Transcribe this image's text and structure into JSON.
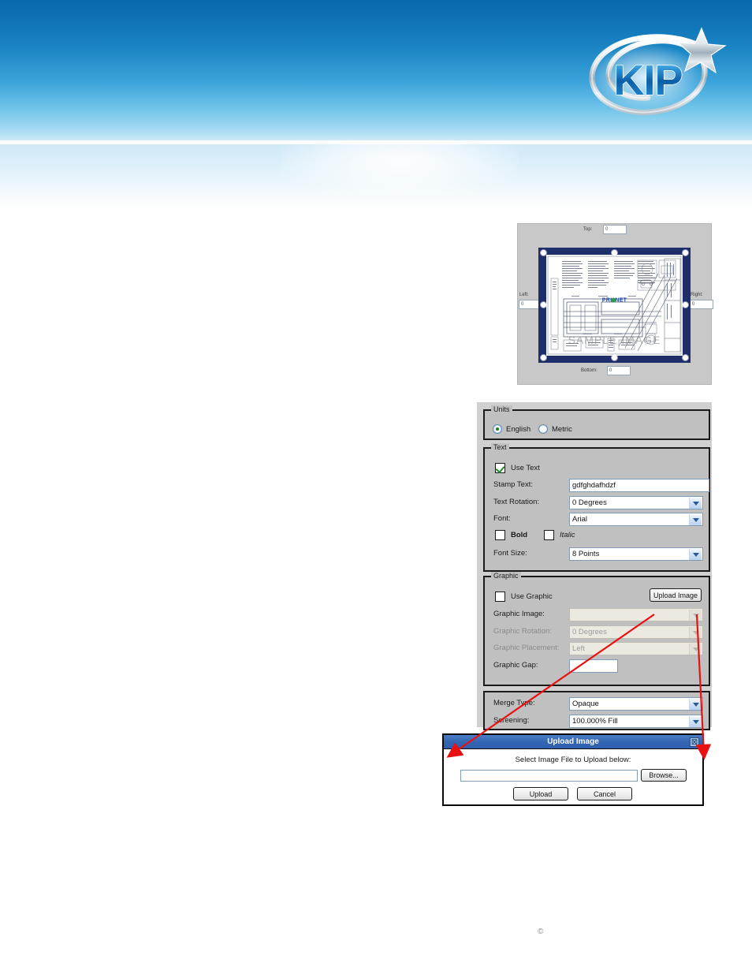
{
  "brand": {
    "logo_text": "KIP",
    "logo_name": "kip-logo",
    "banner_top_color": "#0a69ad",
    "banner_bottom_color": "#cdeaf8"
  },
  "preview": {
    "panel_name": "stamp-preview-panel",
    "top_label": "Top:",
    "top_value": "0",
    "left_label": "Left:",
    "left_value": "0",
    "right_label": "Right:",
    "right_value": "0",
    "bottom_label": "Bottom:",
    "bottom_value": "0",
    "watermark": "SAMPLE IMAGE",
    "drawing_logo": "PRINTNET",
    "frame_color": "#1e2e6b"
  },
  "form": {
    "units": {
      "legend": "Units",
      "options": [
        "English",
        "Metric"
      ],
      "selected": "English"
    },
    "text": {
      "legend": "Text",
      "use_text_label": "Use Text",
      "use_text_checked": true,
      "stamp_text_label": "Stamp Text:",
      "stamp_text_value": "gdfghdafhdzf",
      "text_rotation_label": "Text Rotation:",
      "text_rotation_value": "0 Degrees",
      "font_label": "Font:",
      "font_value": "Arial",
      "bold_label": "Bold",
      "bold_checked": false,
      "italic_label": "Italic",
      "italic_checked": false,
      "font_size_label": "Font Size:",
      "font_size_value": "8 Points"
    },
    "graphic": {
      "legend": "Graphic",
      "use_graphic_label": "Use Graphic",
      "use_graphic_checked": false,
      "upload_image_button": "Upload Image",
      "graphic_image_label": "Graphic Image:",
      "graphic_image_value": "",
      "graphic_rotation_label": "Graphic Rotation:",
      "graphic_rotation_value": "0 Degrees",
      "graphic_placement_label": "Graphic Placement:",
      "graphic_placement_value": "Left",
      "graphic_gap_label": "Graphic Gap:",
      "graphic_gap_value": ""
    },
    "merge": {
      "merge_type_label": "Merge Type:",
      "merge_type_value": "Opaque",
      "screening_label": "Screening:",
      "screening_value": "100.000% Fill"
    }
  },
  "upload_dialog": {
    "title": "Upload Image",
    "close_glyph": "☒",
    "instruction": "Select Image File to Upload below:",
    "file_value": "",
    "browse_label": "Browse...",
    "upload_label": "Upload",
    "cancel_label": "Cancel"
  },
  "annotations": {
    "arrow_color": "#e81010",
    "arrow_count": 2
  },
  "footer": {
    "copyright_glyph": "©"
  }
}
